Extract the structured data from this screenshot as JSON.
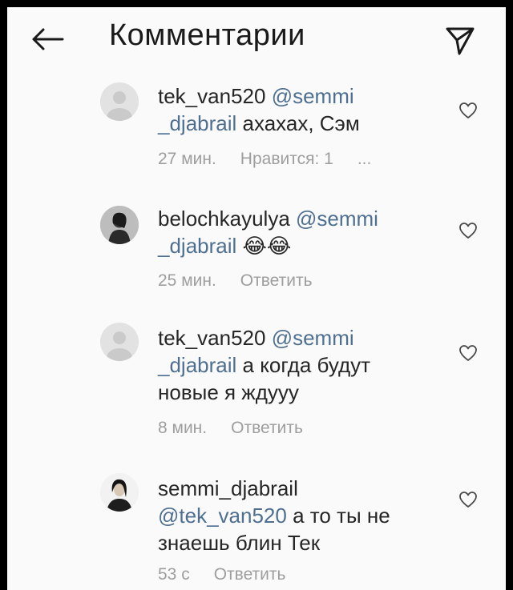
{
  "header": {
    "title": "Комментарии",
    "back_icon": "arrow-left-icon",
    "send_icon": "paper-plane-icon"
  },
  "comments": [
    {
      "username": "tek_van520",
      "mention": "@semmi _djabrail",
      "mention_line1": "@semmi",
      "mention_line2": "_djabrail",
      "text": "ахахах, Сэм",
      "time": "27 мин.",
      "likes": "Нравится: 1",
      "more": "...",
      "avatar": "default-avatar-icon"
    },
    {
      "username": "belochkayulya",
      "mention_line1": "@semmi",
      "mention_line2": "_djabrail",
      "text": "😂😂",
      "time": "25 мин.",
      "reply": "Ответить",
      "avatar": "profile-photo"
    },
    {
      "username": "tek_van520",
      "mention_line1": "@semmi",
      "mention_line2": "_djabrail",
      "text_line1": "а когда будут",
      "text_line2": "новые я ждууу",
      "time": "8 мин.",
      "reply": "Ответить",
      "avatar": "default-avatar-icon"
    },
    {
      "username": "semmi_djabrail",
      "mention": "@tek_van520",
      "text_line1": "а то ты не",
      "text_line2": "знаешь блин Тек",
      "time": "53 с",
      "reply": "Ответить",
      "avatar": "profile-photo"
    }
  ],
  "colors": {
    "background": "#fafafa",
    "text": "#262626",
    "mention": "#4f6f91",
    "meta": "#9e9e9e"
  }
}
